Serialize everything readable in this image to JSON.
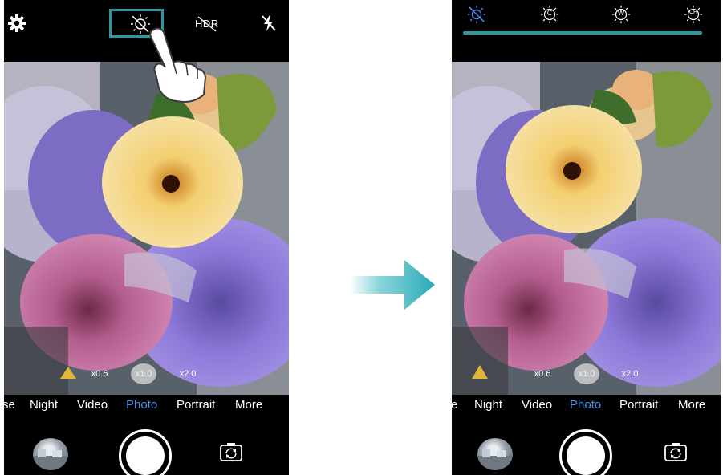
{
  "left_screen": {
    "top_icons": [
      "settings-gear-icon",
      "white-balance-icon",
      "hdr-off-icon",
      "flash-off-icon"
    ],
    "hdr_label": "HDR",
    "modes": [
      "se",
      "Night",
      "Video",
      "Photo",
      "Portrait",
      "More"
    ],
    "active_mode": "Photo",
    "zoom_levels": [
      "x0.6",
      "x1.0",
      "x2.0"
    ],
    "active_zoom": "x1.0"
  },
  "right_screen": {
    "white_balance_options": [
      "wb-auto-off-icon",
      "wb-cloudy-icon",
      "wb-w-icon",
      "wb-custom-icon"
    ],
    "wb_letters": [
      "C",
      "W",
      "CH"
    ],
    "modes": [
      "e",
      "Night",
      "Video",
      "Photo",
      "Portrait",
      "More"
    ],
    "active_mode": "Photo",
    "zoom_levels": [
      "x0.6",
      "x1.0",
      "x2.0"
    ],
    "active_zoom": "x1.0"
  },
  "colors": {
    "accent_teal": "#2b9aa0",
    "active_mode_blue": "#4a8fe0",
    "arrow_teal": "#39b8c2"
  }
}
